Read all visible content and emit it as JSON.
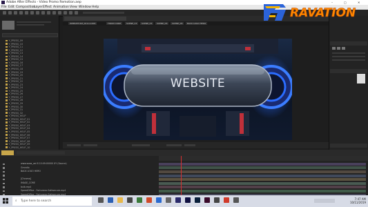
{
  "window": {
    "title": "Adobe After Effects - Video Promo Remotion.aep",
    "controls": [
      "–",
      "▢",
      "✕"
    ]
  },
  "menu": [
    "File",
    "Edit",
    "Composition",
    "Layer",
    "Effect",
    "Animation",
    "View",
    "Window",
    "Help"
  ],
  "watermark": {
    "text": "RAVATION"
  },
  "project": {
    "items": [
      "Y_PRESS_09",
      "Y_PRESS_10",
      "Y_PRESS_11",
      "Y_PRESS_12",
      "Y_PRESS_13",
      "Y_PRESS_14",
      "Y_PRESS_15",
      "Y_PRESS_16",
      "Y_PRESS_17",
      "Y_PRESS_18",
      "Y_PRESS_19",
      "Y_PRESS_20",
      "Y_PRESS_21",
      "Y_PRESS_22",
      "Y_PRESS_23",
      "Y_PRESS_24",
      "Y_PRESS_25",
      "Y_PRESS_26",
      "Y_PRESS_27",
      "Y_PRESS_28",
      "Y_PRESS_29",
      "Y_PRESS_30",
      "Y_PRESS_31",
      "Y_PRESS_32",
      "Y_PRESS_HELP",
      "Y_PRESS_HELP_01",
      "Y_PRESS_HELP_02",
      "Y_PRESS_HELP_03",
      "Y_PRESS_HELP_04",
      "Y_PRESS_HELP_05",
      "Y_PRESS_HELP_06",
      "Y_PRESS_HELP_07",
      "Y_PRESS_HELP_08",
      "Y_PRESS_HELP_09",
      "Y_PRESS_HELP_10"
    ]
  },
  "composition": {
    "crumbs": [
      "WEBSITE RM_001ooo000",
      "FINISH CORE",
      "SCENE_03",
      "SCENE_05",
      "SCENE_06",
      "SCENE_08",
      "BACK LOGO HERO"
    ],
    "screen_text": "WEBSITE"
  },
  "timeline": {
    "layers": [
      "www.www_wd 8 10:09:00000 XY (Source)",
      "Grandio",
      "BACK LOGO HERO",
      "",
      "[Chroma]",
      "IMAGE_CORE",
      "bulb.mp4",
      "SpeedOffice - Fortuneco Safesecure.mp4",
      "SpeedOffice - Fortuneco Safesecure.mp4"
    ]
  },
  "taskbar": {
    "search_placeholder": "Type here to search",
    "time": "7:47 AM",
    "date": "10/11/2019"
  },
  "colors": {
    "accent": "#2b6cff",
    "brand": "#f4b400",
    "playhead": "#d83030"
  }
}
